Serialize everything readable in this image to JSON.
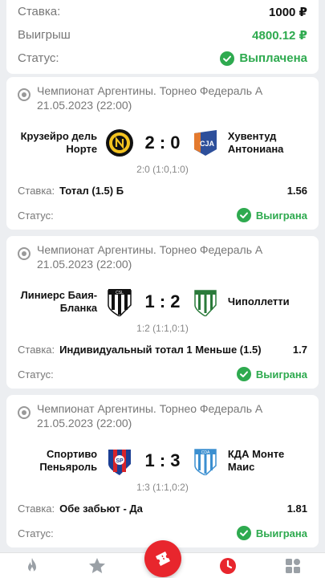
{
  "summary": {
    "stake_label": "Ставка:",
    "stake_value": "1000 ₽",
    "win_label": "Выигрыш",
    "win_value": "4800.12 ₽",
    "status_label": "Статус:",
    "status_value": "Выплачена"
  },
  "matches": [
    {
      "league": "Чемпионат Аргентины. Торнео Федераль А",
      "datetime": "21.05.2023 (22:00)",
      "home": "Крузейро дель Норте",
      "away": "Хувентуд Антониана",
      "home_logo": "cruzeiro-del-norte-logo",
      "away_logo": "juventud-antoniana-logo",
      "score": "2 : 0",
      "partial": "2:0 (1:0,1:0)",
      "bet_label": "Ставка:",
      "bet_name": "Тотал (1.5) Б",
      "odd": "1.56",
      "status_label": "Статус:",
      "status_value": "Выиграна"
    },
    {
      "league": "Чемпионат Аргентины. Торнео Федераль А",
      "datetime": "21.05.2023 (22:00)",
      "home": "Линиерс Баия-Бланка",
      "away": "Чиполлетти",
      "home_logo": "liniers-logo",
      "away_logo": "cipolletti-logo",
      "score": "1 : 2",
      "partial": "1:2 (1:1,0:1)",
      "bet_label": "Ставка:",
      "bet_name": "Индивидуальный тотал 1 Меньше (1.5)",
      "odd": "1.7",
      "status_label": "Статус:",
      "status_value": "Выиграна"
    },
    {
      "league": "Чемпионат Аргентины. Торнео Федераль А",
      "datetime": "21.05.2023 (22:00)",
      "home": "Спортиво Пеньяроль",
      "away": "КДА Монте Маис",
      "home_logo": "sportivo-penarol-logo",
      "away_logo": "cda-monte-maiz-logo",
      "score": "1 : 3",
      "partial": "1:3 (1:1,0:2)",
      "bet_label": "Ставка:",
      "bet_name": "Обе забьют - Да",
      "odd": "1.81",
      "status_label": "Статус:",
      "status_value": "Выиграна"
    }
  ],
  "colors": {
    "win_green": "#2eaa4f",
    "accent_red": "#e8262d",
    "active_tab": "#e8262d",
    "inactive_tab": "#9aa0a6"
  },
  "tabbar": {
    "items": [
      "fire-icon",
      "star-icon",
      "ticket-icon",
      "clock-icon",
      "grid-icon"
    ],
    "active": "clock-icon"
  }
}
